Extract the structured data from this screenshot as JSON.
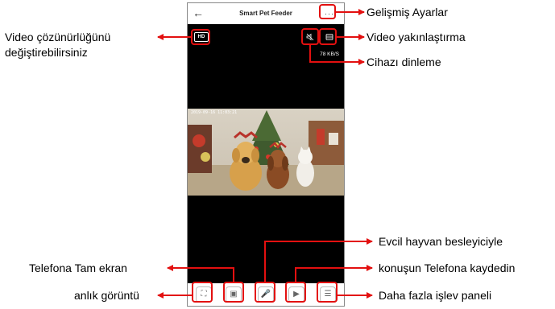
{
  "app": {
    "title": "Smart Pet Feeder",
    "back_icon": "arrow-left-icon",
    "more_icon": "more-dots-icon",
    "more_glyph": "···",
    "resolution_badge": "HD",
    "speed": "78 KB/S",
    "timestamp": "2019-09-16 11:03:21",
    "bottom_buttons": [
      "fullscreen-icon",
      "snapshot-icon",
      "microphone-icon",
      "record-icon",
      "more-panel-icon"
    ]
  },
  "annotations": {
    "advanced_settings": "Gelişmiş Ayarlar",
    "resolution_line1": "Video çözünürlüğünü",
    "resolution_line2": "değiştirebilirsiniz",
    "zoom": "Video yakınlaştırma",
    "listen": "Cihazı dinleme",
    "talk": "Evcil hayvan besleyiciyle",
    "record": "konuşun Telefona kaydedin",
    "fullscreen": "Telefona Tam ekran",
    "snapshot": "anlık görüntü",
    "more_panel": "Daha fazla işlev paneli"
  },
  "colors": {
    "annotation": "#e31010",
    "video_bg": "#000000"
  }
}
